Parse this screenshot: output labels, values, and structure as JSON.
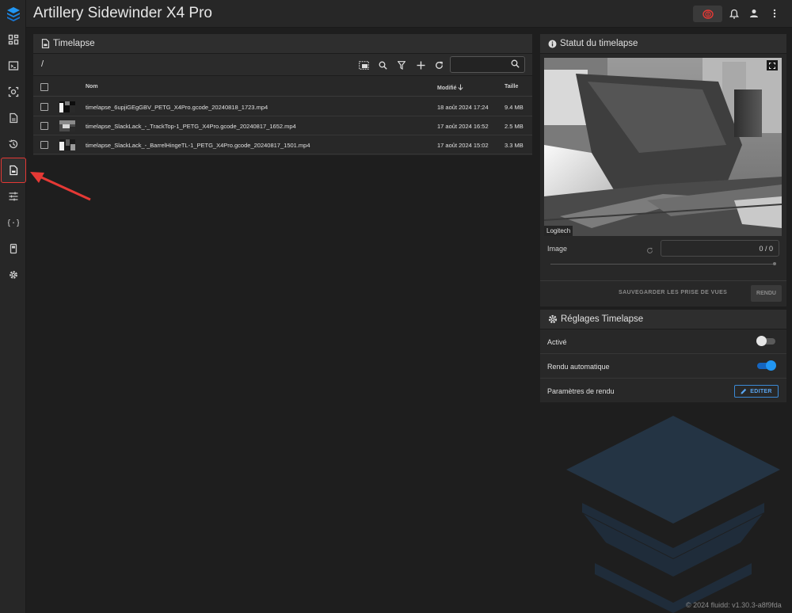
{
  "app": {
    "title": "Artillery Sidewinder X4 Pro",
    "brand_color": "#2196f3",
    "accent_red": "#e53935"
  },
  "sidebar": {
    "items": [
      {
        "name": "dashboard",
        "icon": "dashboard-icon",
        "active": false
      },
      {
        "name": "console",
        "icon": "console-icon",
        "active": false
      },
      {
        "name": "camera",
        "icon": "camera-icon",
        "active": false
      },
      {
        "name": "jobs",
        "icon": "file-icon",
        "active": false
      },
      {
        "name": "history",
        "icon": "history-icon",
        "active": false
      },
      {
        "name": "timelapse",
        "icon": "timelapse-file-icon",
        "active": true
      },
      {
        "name": "tune",
        "icon": "tune-icon",
        "active": false
      },
      {
        "name": "configuration",
        "icon": "code-braces-icon",
        "active": false
      },
      {
        "name": "system",
        "icon": "device-icon",
        "active": false
      },
      {
        "name": "settings",
        "icon": "gear-icon",
        "active": false
      }
    ]
  },
  "timelapse": {
    "title": "Timelapse",
    "path": "/",
    "search_placeholder": "",
    "columns": {
      "name": "Nom",
      "modified": "Modifié",
      "size": "Taille"
    },
    "files": [
      {
        "name": "timelapse_6upjiGEgGBV_PETG_X4Pro.gcode_20240818_1723.mp4",
        "modified": "18 août 2024 17:24",
        "size": "9.4 MB"
      },
      {
        "name": "timelapse_SlackLack_-_TrackTop-1_PETG_X4Pro.gcode_20240817_1652.mp4",
        "modified": "17 août 2024 16:52",
        "size": "2.5 MB"
      },
      {
        "name": "timelapse_SlackLack_-_BarrelHingeTL-1_PETG_X4Pro.gcode_20240817_1501.mp4",
        "modified": "17 août 2024 15:02",
        "size": "3.3 MB"
      }
    ]
  },
  "status": {
    "title": "Statut du timelapse",
    "camera_label": "Logitech",
    "image_label": "Image",
    "frame_value": "0 / 0",
    "save_label": "SAUVEGARDER LES PRISE DE VUES",
    "render_label": "RENDU"
  },
  "settings": {
    "title": "Réglages Timelapse",
    "enabled_label": "Activé",
    "enabled": false,
    "auto_render_label": "Rendu automatique",
    "auto_render": true,
    "render_params_label": "Paramètres de rendu",
    "edit_label": "EDITER"
  },
  "footer": {
    "text": "© 2024 fluidd: v1.30.3-a8f9fda"
  }
}
